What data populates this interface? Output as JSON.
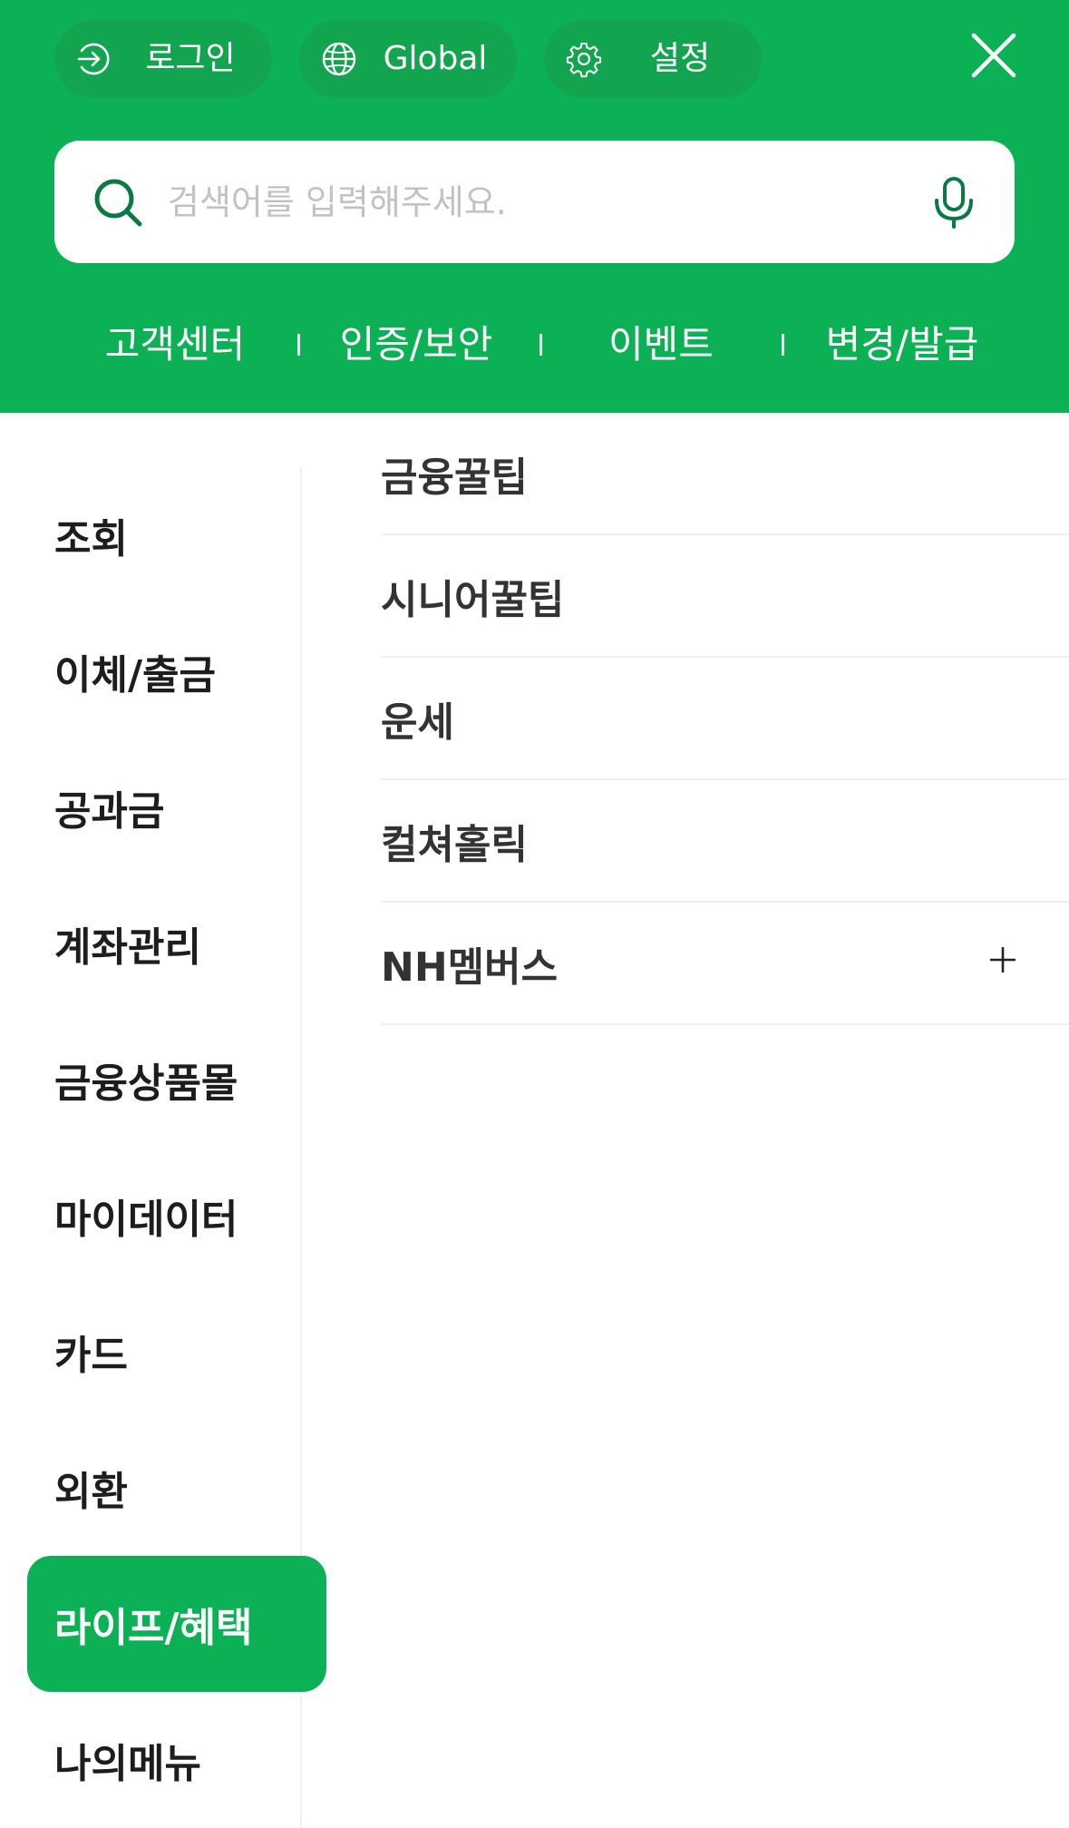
{
  "header": {
    "login_label": "로그인",
    "global_label": "Global",
    "settings_label": "설정"
  },
  "search": {
    "placeholder": "검색어를 입력해주세요."
  },
  "quick_links": [
    "고객센터",
    "인증/보안",
    "이벤트",
    "변경/발급"
  ],
  "categories": [
    {
      "label": "조회"
    },
    {
      "label": "이체/출금"
    },
    {
      "label": "공과금"
    },
    {
      "label": "계좌관리"
    },
    {
      "label": "금융상품몰"
    },
    {
      "label": "마이데이터"
    },
    {
      "label": "카드"
    },
    {
      "label": "외환"
    },
    {
      "label": "라이프/혜택"
    },
    {
      "label": "나의메뉴"
    }
  ],
  "active_category": "라이프/혜택",
  "submenu": [
    {
      "label": "금융꿀팁"
    },
    {
      "label": "시니어꿀팁"
    },
    {
      "label": "운세"
    },
    {
      "label": "컬쳐홀릭"
    },
    {
      "label": "NH멤버스",
      "expandable": true
    }
  ],
  "colors": {
    "brand_green": "#0db155",
    "pill_green": "#12a44f",
    "icon_dark_green": "#0a7a45"
  },
  "icons": {
    "login": "login-arrow-icon",
    "global": "globe-icon",
    "settings": "gear-icon",
    "close": "close-icon",
    "search": "search-icon",
    "mic": "microphone-icon",
    "expand": "plus-icon"
  }
}
